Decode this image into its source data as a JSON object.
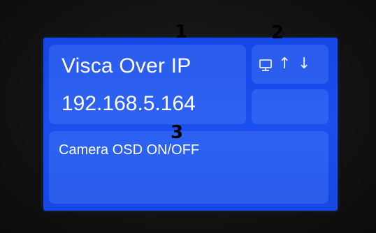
{
  "display": {
    "title": "Visca Over IP",
    "ip_address": "192.168.5.164",
    "osd_label": "Camera OSD ON/OFF",
    "markers": [
      "1",
      "2",
      "3"
    ]
  },
  "icons": {
    "network": "network-computer-icon",
    "upload": "arrow-up-icon",
    "download": "arrow-down-icon"
  },
  "colors": {
    "screen_blue": "#1a4ff0",
    "text": "#ffffff",
    "marker": "#000000"
  }
}
